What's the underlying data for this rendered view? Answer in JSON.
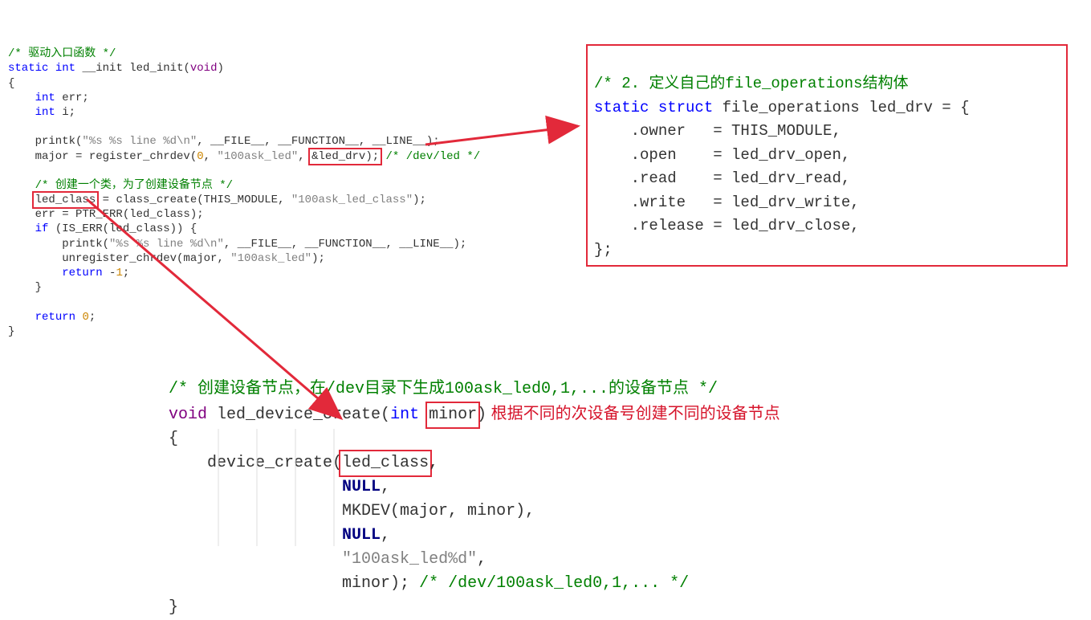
{
  "code1": {
    "c1": "/* 驱动入口函数 */",
    "c2_a": "static",
    "c2_b": "int",
    "c2_c": " __init led_init(",
    "c2_d": "void",
    "c2_e": ")",
    "c3": "{",
    "c4_a": "int",
    "c4_b": " err;",
    "c5_a": "int",
    "c5_b": " i;",
    "c6_a": "    printk(",
    "c6_b": "\"%s %s line %d\\n\"",
    "c6_c": ", __FILE__, __FUNCTION__, __LINE__);",
    "c7_a": "    major = register_chrdev(",
    "c7_b": "0",
    "c7_c": ", ",
    "c7_d": "\"100ask_led\"",
    "c7_e": ", ",
    "c7_box": "&led_drv);",
    "c7_cmt": " /* /dev/led */",
    "c8": "/* 创建一个类，为了创建设备节点 */",
    "c9_box": "led_class",
    "c9_b": " = class_create(THIS_MODULE, ",
    "c9_c": "\"100ask_led_class\"",
    "c9_d": ");",
    "c10": "    err = PTR_ERR(led_class);",
    "c11_a": "if",
    "c11_b": " (IS_ERR(led_class)) {",
    "c12_a": "        printk(",
    "c12_b": "\"%s %s line %d\\n\"",
    "c12_c": ", __FILE__, __FUNCTION__, __LINE__);",
    "c13_a": "        unregister_chrdev(major, ",
    "c13_b": "\"100ask_led\"",
    "c13_c": ");",
    "c14_a": "return",
    "c14_b": " -",
    "c14_c": "1",
    "c14_d": ";",
    "c15": "    }",
    "c16_a": "return",
    "c16_b": " ",
    "c16_c": "0",
    "c16_d": ";",
    "c17": "}"
  },
  "code2": {
    "c1": "/* 2. 定义自己的file_operations结构体",
    "c2_a": "static",
    "c2_b": "struct",
    "c2_c": " file_operations led_drv = {",
    "c3": "    .owner   = THIS_MODULE,",
    "c4": "    .open    = led_drv_open,",
    "c5": "    .read    = led_drv_read,",
    "c6": "    .write   = led_drv_write,",
    "c7": "    .release = led_drv_close,",
    "c8": "};"
  },
  "code3": {
    "c1": "/* 创建设备节点，在/dev目录下生成100ask_led0,1,...的设备节点 */",
    "c2_a": "void",
    "c2_b": " led_device_create(",
    "c2_c": "int",
    "c2_box": "minor",
    "c2_d": ")",
    "note": " 根据不同的次设备号创建不同的设备节点",
    "c3": "{",
    "c4_a": "    device_create(",
    "c4_box": "led_class",
    "c4_b": ",",
    "c5_a": "NULL",
    "c5_b": ",",
    "c6": "                  MKDEV(major, minor),",
    "c7_a": "NULL",
    "c7_b": ",",
    "c8": "\"100ask_led%d\"",
    "c8_b": ",",
    "c9_a": "                  minor); ",
    "c9_b": "/* /dev/100ask_led0,1,... */",
    "c10": "}"
  }
}
